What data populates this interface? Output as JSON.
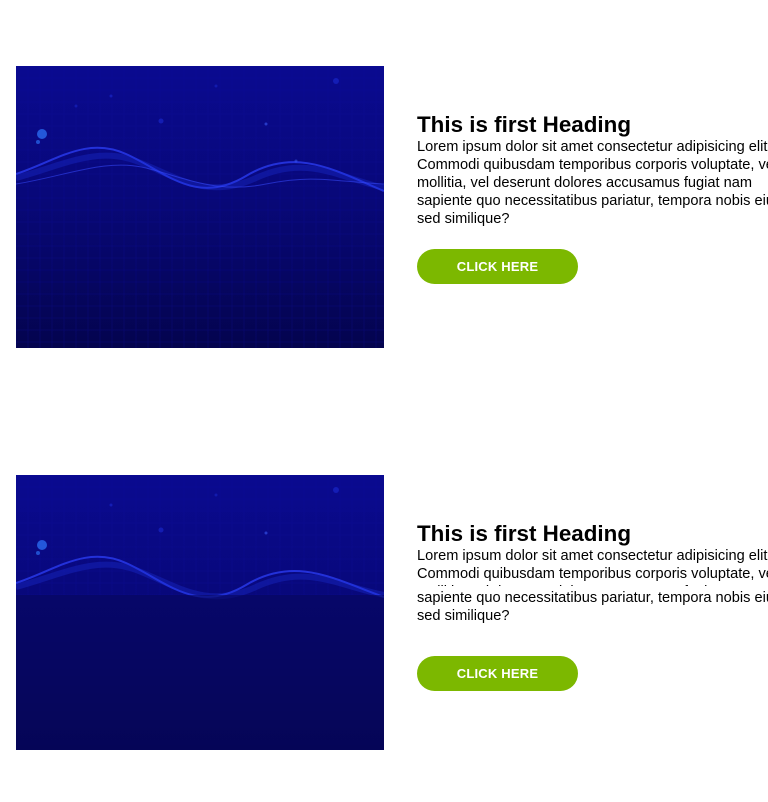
{
  "sections": [
    {
      "heading": "This is first Heading",
      "body": "Lorem ipsum dolor sit amet consectetur adipisicing elit. Commodi quibusdam temporibus corporis voluptate, vero mollitia, vel deserunt dolores accusamus fugiat nam sapiente quo necessitatibus pariatur, tempora nobis eius sed similique?",
      "button_label": "CLICK HERE"
    },
    {
      "heading": "This is first Heading",
      "body": "Lorem ipsum dolor sit amet consectetur adipisicing elit. Commodi quibusdam temporibus corporis voluptate, vero mollitia, vel deserunt dolores accusamus fugiat nam sapiente quo necessitatibus pariatur, tempora nobis eius sed similique?",
      "button_label": "CLICK HERE"
    }
  ],
  "colors": {
    "button_bg": "#7cb800",
    "button_text": "#ffffff",
    "image_top": "#0a0a8c",
    "image_bottom": "#05054a"
  }
}
